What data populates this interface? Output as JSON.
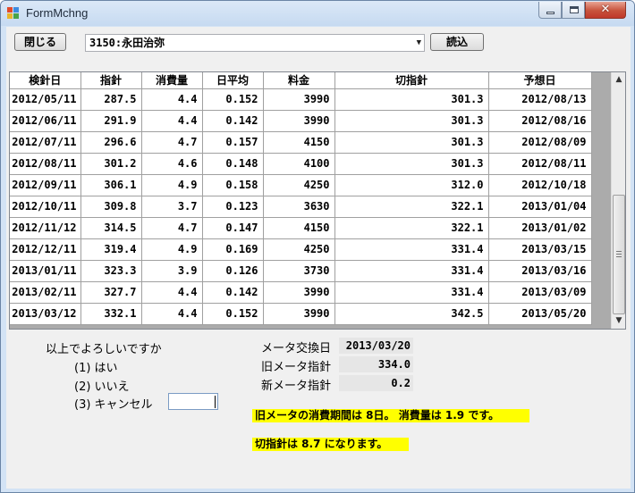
{
  "window": {
    "title": "FormMchng",
    "close_glyph": "✕"
  },
  "toolbar": {
    "close_label": "閉じる",
    "customer_select": "3150:永田治弥",
    "load_label": "読込"
  },
  "grid": {
    "columns": [
      "検針日",
      "指針",
      "消費量",
      "日平均",
      "料金",
      "切指針",
      "予想日"
    ],
    "rows": [
      [
        "2012/05/11",
        "287.5",
        "4.4",
        "0.152",
        "3990",
        "301.3",
        "2012/08/13"
      ],
      [
        "2012/06/11",
        "291.9",
        "4.4",
        "0.142",
        "3990",
        "301.3",
        "2012/08/16"
      ],
      [
        "2012/07/11",
        "296.6",
        "4.7",
        "0.157",
        "4150",
        "301.3",
        "2012/08/09"
      ],
      [
        "2012/08/11",
        "301.2",
        "4.6",
        "0.148",
        "4100",
        "301.3",
        "2012/08/11"
      ],
      [
        "2012/09/11",
        "306.1",
        "4.9",
        "0.158",
        "4250",
        "312.0",
        "2012/10/18"
      ],
      [
        "2012/10/11",
        "309.8",
        "3.7",
        "0.123",
        "3630",
        "322.1",
        "2013/01/04"
      ],
      [
        "2012/11/12",
        "314.5",
        "4.7",
        "0.147",
        "4150",
        "322.1",
        "2013/01/02"
      ],
      [
        "2012/12/11",
        "319.4",
        "4.9",
        "0.169",
        "4250",
        "331.4",
        "2013/03/15"
      ],
      [
        "2013/01/11",
        "323.3",
        "3.9",
        "0.126",
        "3730",
        "331.4",
        "2013/03/16"
      ],
      [
        "2013/02/11",
        "327.7",
        "4.4",
        "0.142",
        "3990",
        "331.4",
        "2013/03/09"
      ],
      [
        "2013/03/12",
        "332.1",
        "4.4",
        "0.152",
        "3990",
        "342.5",
        "2013/05/20"
      ]
    ]
  },
  "prompt": {
    "question": "以上でよろしいですか",
    "opt1": "(1) はい",
    "opt2": "(2) いいえ",
    "opt3": "(3) キャンセル",
    "input_value": ""
  },
  "meter": {
    "exchange_date_label": "メータ交換日",
    "exchange_date": "2013/03/20",
    "old_reading_label": "旧メータ指針",
    "old_reading": "334.0",
    "new_reading_label": "新メータ指針",
    "new_reading": "0.2"
  },
  "messages": {
    "line1": "旧メータの消費期間は 8日。 消費量は 1.9 です。",
    "line2": "切指針は 8.7 になります。"
  },
  "colors": {
    "highlight": "#ffff00",
    "close_button": "#c0392b"
  }
}
